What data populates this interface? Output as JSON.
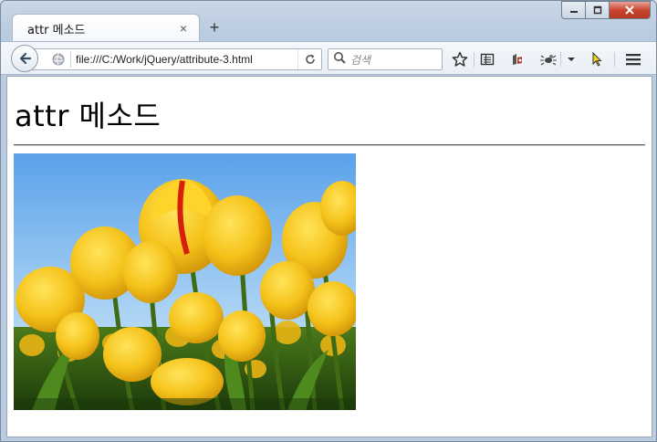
{
  "tab": {
    "title": "attr 메소드",
    "close_glyph": "×",
    "new_tab_glyph": "+"
  },
  "window_controls": [
    "minimize",
    "maximize",
    "close"
  ],
  "navigation": {
    "url": "file:///C:/Work/jQuery/attribute-3.html",
    "search_placeholder": "검색"
  },
  "toolbar_icons": [
    "star-icon",
    "reading-list-icon",
    "addon-icon",
    "bug-icon",
    "dropdown-arrow-icon",
    "cursor-icon",
    "menu-icon"
  ],
  "page": {
    "heading": "attr 메소드",
    "image_subject": "yellow tulips under a blue sky"
  },
  "colors": {
    "accent": "#3c6fb4",
    "close_button": "#c8452f",
    "tulip_yellow": "#f5c21a",
    "sky": "#7db8ee"
  }
}
